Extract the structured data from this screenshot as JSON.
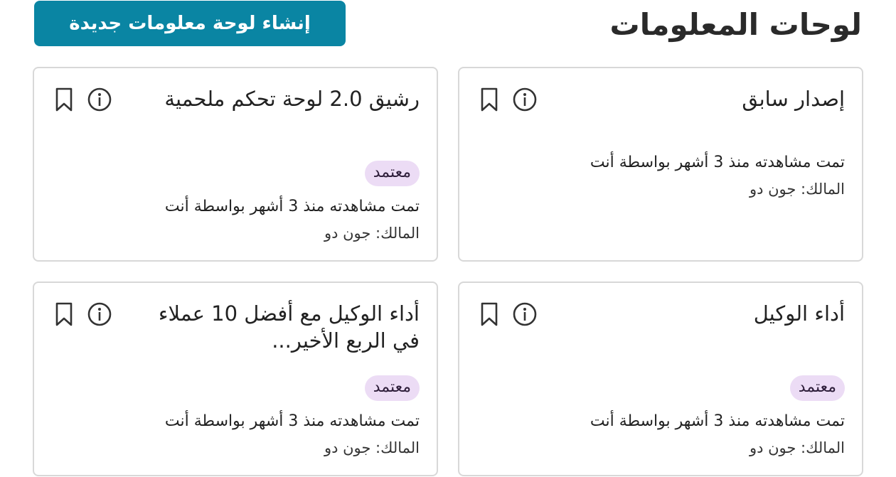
{
  "header": {
    "title": "لوحات المعلومات",
    "create_button": "إنشاء لوحة معلومات جديدة"
  },
  "cards": [
    {
      "title": "إصدار سابق",
      "badge": "",
      "viewed": "تمت مشاهدته منذ 3 أشهر بواسطة أنت",
      "owner": "المالك: جون دو"
    },
    {
      "title": "رشيق 2.0 لوحة تحكم ملحمية",
      "badge": "معتمد",
      "viewed": "تمت مشاهدته منذ 3 أشهر بواسطة أنت",
      "owner": "المالك: جون دو"
    },
    {
      "title": "أداء الوكيل",
      "badge": "معتمد",
      "viewed": "تمت مشاهدته منذ 3 أشهر بواسطة أنت",
      "owner": "المالك: جون دو"
    },
    {
      "title": "أداء الوكيل مع أفضل 10 عملاء في الربع الأخير...",
      "badge": "معتمد",
      "viewed": "تمت مشاهدته منذ 3 أشهر بواسطة أنت",
      "owner": "المالك: جون دو"
    }
  ],
  "icons": {
    "info": "info-icon",
    "bookmark": "bookmark-icon"
  },
  "colors": {
    "accent": "#0a85a3",
    "badge_bg": "#ecdcf5",
    "border": "#d8d8d8"
  }
}
